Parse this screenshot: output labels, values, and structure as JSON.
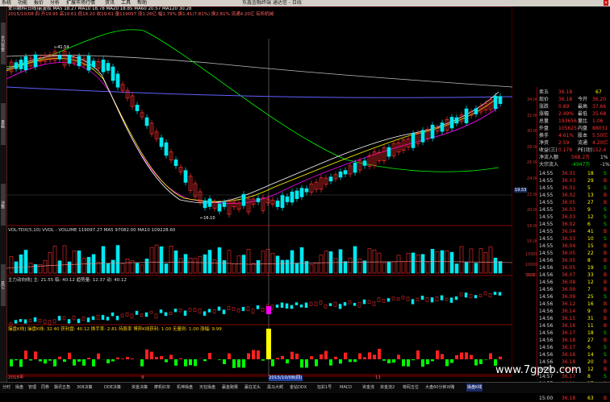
{
  "window": {
    "menu": [
      "系统",
      "功能",
      "报价",
      "分析",
      "扩展市场行情",
      "资讯",
      "工具",
      "帮助"
    ],
    "title": "东鑫金融终端 通达信 - 日线"
  },
  "stock_info": {
    "line1": "爱尔眼科(日线)前复权 MA5 18.27 MA10 18.78 MA20 18.85 MA60 20.57 MA120 30.28",
    "line2": "2015/10/08 四 开19.95 高19.61 低18.20 收19.61 量119097 涨1.26亿 幅1.79% 振1.41(7.81%) 换2.81% 流通4.20亿 有所机械"
  },
  "price_axis": [
    "34.00",
    "32.00",
    "30.00",
    "28.00",
    "26.00",
    "24.00",
    "22.00",
    "20.00",
    "18.00",
    "16.00"
  ],
  "price_marker": "19.53",
  "annotations": {
    "high": "41.54",
    "low": "16.10"
  },
  "volume_panel": {
    "label": "VOL-TDX(5,10) VVOL -  VOLUME 119097.27 MA5 97082.00 MA10 109228.60",
    "axis": [
      "15000",
      "10000",
      "5000"
    ],
    "unit": "X10"
  },
  "indicator1": {
    "label": "主力动向线] 主: 21.55  临: 40.12  趋势量: 12.37  动: 40.12"
  },
  "indicator2": {
    "label": "操盘K线] 操盘K线: 32.40  获利盘: 40.12  换手率: 2.81  持股率   博弈K线获利: 1.00  无量则: 1.00   涨幅: 9.99"
  },
  "date_labels": [
    "2015年",
    "9",
    "2015/10/08(四)",
    "11"
  ],
  "right_panel": {
    "title": "卖五",
    "rows": [
      {
        "k": "卖五",
        "v": "36.18",
        "n": "67"
      },
      {
        "k": "现价",
        "v": "36.18",
        "k2": "今开",
        "v2": "36.20"
      },
      {
        "k": "涨跌",
        "v": "0.89",
        "k2": "最高",
        "v2": "37.66"
      },
      {
        "k": "涨幅",
        "v": "2.49%",
        "k2": "最低",
        "v2": "35.68"
      },
      {
        "k": "总量",
        "v": "193656",
        "k2": "量比",
        "v2": "1.06"
      },
      {
        "k": "外盘",
        "v": "105625",
        "k2": "内盘",
        "v2": "88031"
      },
      {
        "k": "换手",
        "v": "4.61%",
        "k2": "股本",
        "v2": "5.50亿"
      },
      {
        "k": "净资",
        "v": "2.59",
        "k2": "流通",
        "v2": "4.20亿"
      },
      {
        "k": "收益(三)",
        "v": "0.178",
        "k2": "PE(动)",
        "v2": "152.4"
      }
    ],
    "flow": [
      {
        "k": "净流入额",
        "v": "568.2万",
        "p": "1%"
      },
      {
        "k": "大宗流入",
        "v": "-4947万",
        "p": "-1%"
      }
    ],
    "ticks": [
      {
        "t": "14:55",
        "p": "36.01",
        "v": "18",
        "n": "S"
      },
      {
        "t": "14:55",
        "p": "36.03",
        "v": "29",
        "n": "B"
      },
      {
        "t": "14:55",
        "p": "36.01",
        "v": "5",
        "n": "S"
      },
      {
        "t": "14:55",
        "p": "36.02",
        "v": "13",
        "n": "B"
      },
      {
        "t": "14:55",
        "p": "36.05",
        "v": "27",
        "n": "B"
      },
      {
        "t": "14:55",
        "p": "36.03",
        "v": "9",
        "n": "S"
      },
      {
        "t": "14:55",
        "p": "36.03",
        "v": "12",
        "n": "S"
      },
      {
        "t": "14:55",
        "p": "36.02",
        "v": "6",
        "n": "S"
      },
      {
        "t": "14:55",
        "p": "36.04",
        "v": "41",
        "n": "B"
      },
      {
        "t": "14:55",
        "p": "36.03",
        "v": "10",
        "n": "S"
      },
      {
        "t": "14:55",
        "p": "36.04",
        "v": "15",
        "n": "B"
      },
      {
        "t": "14:55",
        "p": "36.05",
        "v": "22",
        "n": "B"
      },
      {
        "t": "14:56",
        "p": "36.05",
        "v": "8",
        "n": "B"
      },
      {
        "t": "14:56",
        "p": "36.05",
        "v": "19",
        "n": "S"
      },
      {
        "t": "14:56",
        "p": "36.07",
        "v": "33",
        "n": "B"
      },
      {
        "t": "14:56",
        "p": "36.08",
        "v": "12",
        "n": "B"
      },
      {
        "t": "14:56",
        "p": "36.09",
        "v": "7",
        "n": "B"
      },
      {
        "t": "14:56",
        "p": "36.09",
        "v": "25",
        "n": "S"
      },
      {
        "t": "14:56",
        "p": "36.12",
        "v": "16",
        "n": "B"
      },
      {
        "t": "14:56",
        "p": "36.14",
        "v": "9",
        "n": "B"
      },
      {
        "t": "14:56",
        "p": "36.15",
        "v": "31",
        "n": "B"
      },
      {
        "t": "14:56",
        "p": "36.16",
        "v": "11",
        "n": "B"
      },
      {
        "t": "14:56",
        "p": "36.17",
        "v": "18",
        "n": "S"
      },
      {
        "t": "14:56",
        "p": "36.18",
        "v": "27",
        "n": "B"
      },
      {
        "t": "14:56",
        "p": "36.17",
        "v": "6",
        "n": "S"
      },
      {
        "t": "14:56",
        "p": "36.16",
        "v": "14",
        "n": "S"
      },
      {
        "t": "14:56",
        "p": "36.18",
        "v": "20",
        "n": "B"
      },
      {
        "t": "14:57",
        "p": "36.18",
        "v": "12",
        "n": "B"
      },
      {
        "t": "14:57",
        "p": "36.17",
        "v": "8",
        "n": "S"
      },
      {
        "t": "14:57",
        "p": "36.18",
        "v": "17",
        "n": "B"
      },
      {
        "t": "14:57",
        "p": "36.18",
        "v": "30",
        "n": "B"
      },
      {
        "t": "15:00",
        "p": "36.18",
        "v": "63",
        "n": "B"
      }
    ]
  },
  "bottom_tabs": [
    "分时",
    "操盘",
    "管理",
    "同券",
    "飘讯五角",
    "308决策",
    "DDE决策",
    "资金决策",
    "摩机红单",
    "机神操盘",
    "天狂操盘",
    "赢金跑赛",
    "赢在龙头",
    "黑马大鳄",
    "金钻DDX",
    "狂彩1号",
    "MACD",
    "资金流",
    "资金流2",
    "筹码五位",
    "大盘60分钟对赌",
    "操盘K线"
  ],
  "left_tabs": [
    "主力资金",
    "量能",
    "决策",
    "其它"
  ],
  "watermark": "www.7gpzb.com",
  "colors": {
    "up": "#ff3030",
    "down": "#00e8f0",
    "ma5": "#ffffff",
    "ma10": "#ffff00",
    "ma20": "#ff00ff",
    "ma60": "#00ff00",
    "ma120": "#6060ff"
  }
}
